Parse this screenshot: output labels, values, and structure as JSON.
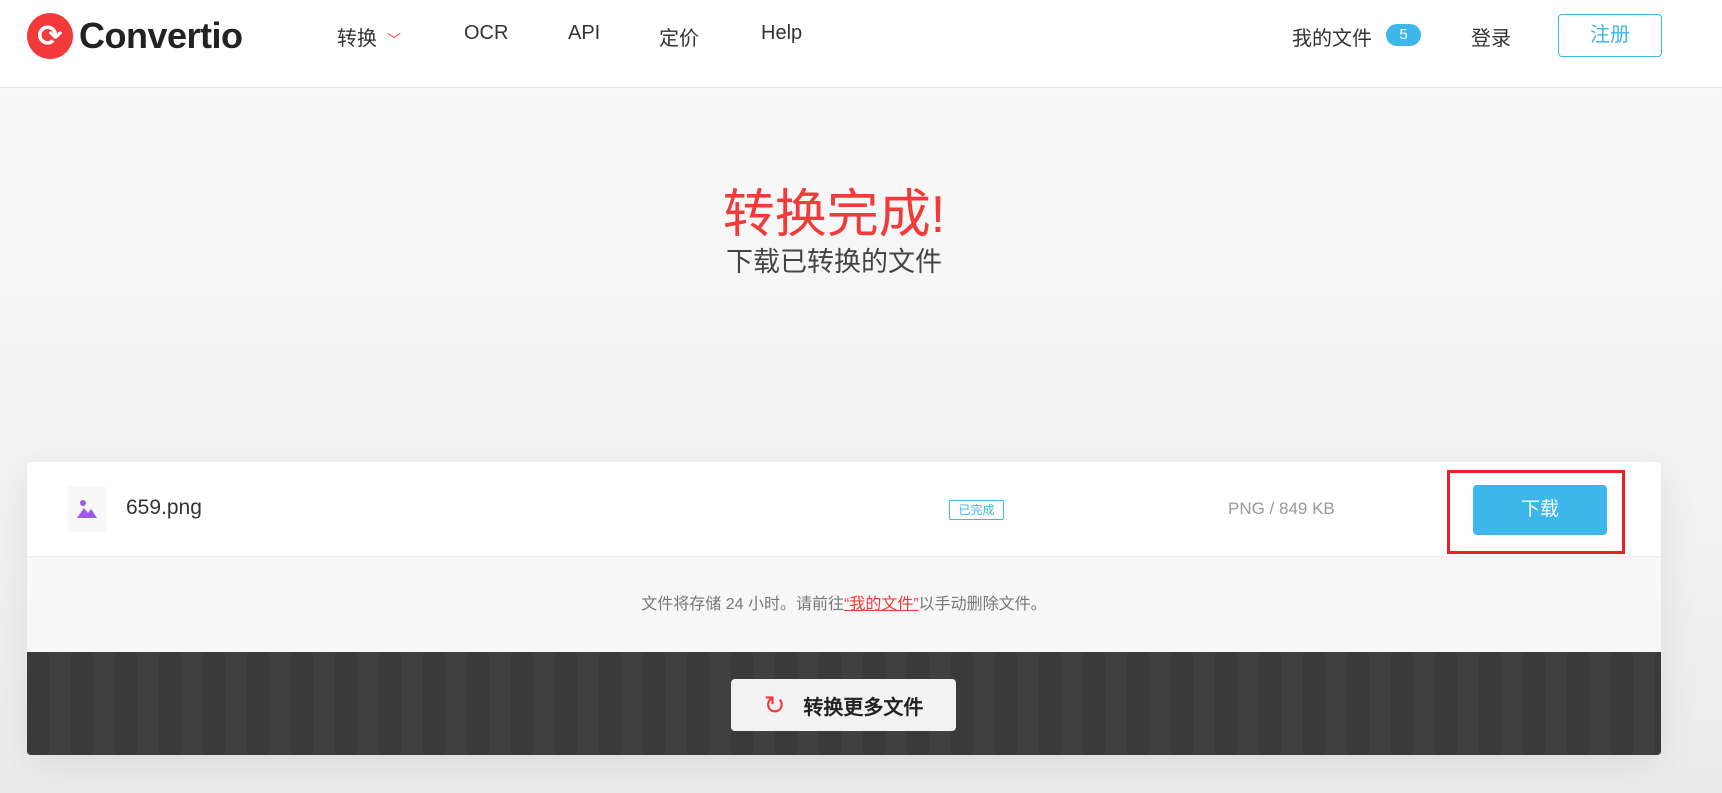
{
  "header": {
    "logo": "Convertio",
    "nav": [
      {
        "label": "转换"
      },
      {
        "label": "OCR"
      },
      {
        "label": "API"
      },
      {
        "label": "定价"
      },
      {
        "label": "Help"
      }
    ],
    "my_files": "我的文件",
    "my_files_count": "5",
    "login": "登录",
    "signup": "注册"
  },
  "hero": {
    "title": "转换完成!",
    "subtitle": "下载已转换的文件"
  },
  "file": {
    "name": "659.png",
    "status": "已完成",
    "meta": "PNG / 849 KB",
    "download": "下载"
  },
  "note": {
    "before": "文件将存储 24 小时。请前往",
    "link": "“我的文件”",
    "after": "以手动删除文件。"
  },
  "convert_more": "转换更多文件",
  "colors": {
    "accent": "#f23a3a",
    "blue": "#3db7e9"
  }
}
